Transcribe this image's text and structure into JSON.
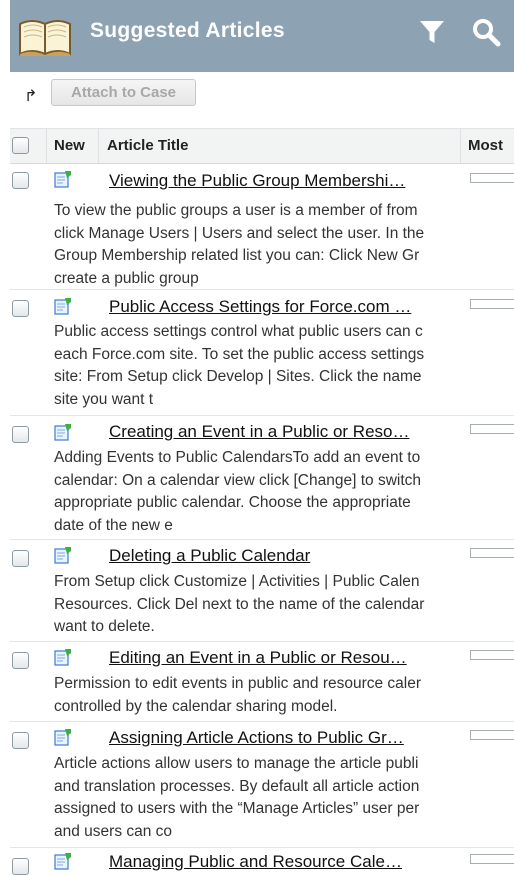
{
  "header": {
    "title": "Suggested Articles",
    "icons": [
      "book-icon",
      "filter-icon",
      "search-icon"
    ],
    "background": "#8da3b4"
  },
  "toolbar": {
    "attach_label": "Attach to Case"
  },
  "table": {
    "columns": [
      "New",
      "Article Title",
      "Most"
    ],
    "rows": [
      {
        "title": "Viewing the Public Group Membershi…",
        "snippet": [
          "To view the public groups a user is a member of from",
          "click Manage Users | Users and select the user. In the",
          "Group Membership related list you can: Click New Gr",
          "create a public group"
        ]
      },
      {
        "title": "Public Access Settings for Force.com …",
        "snippet": [
          "Public access settings control what public users can c",
          "each Force.com site. To set the public access settings",
          "site: From Setup click Develop | Sites. Click the name",
          "site you want t"
        ]
      },
      {
        "title": "Creating an Event in a Public or Reso…",
        "snippet": [
          "Adding Events to Public CalendarsTo add an event to",
          "calendar: On a calendar view click [Change] to switch",
          "appropriate public calendar. Choose the appropriate",
          "date of the new e"
        ]
      },
      {
        "title": "Deleting a Public Calendar",
        "snippet": [
          "From Setup click Customize | Activities | Public Calen",
          "Resources. Click Del next to the name of the calendar",
          "want to delete."
        ]
      },
      {
        "title": "Editing an Event in a Public or Resou…",
        "snippet": [
          "Permission to edit events in public and resource caler",
          "controlled by the calendar sharing model."
        ]
      },
      {
        "title": "Assigning Article Actions to Public Gr…",
        "snippet": [
          "Article actions allow users to manage the article publi",
          "and translation processes. By default all article action",
          "assigned to users with the “Manage Articles” user per",
          "and users can co"
        ]
      },
      {
        "title": "Managing Public and Resource Cale…",
        "snippet": []
      }
    ]
  }
}
